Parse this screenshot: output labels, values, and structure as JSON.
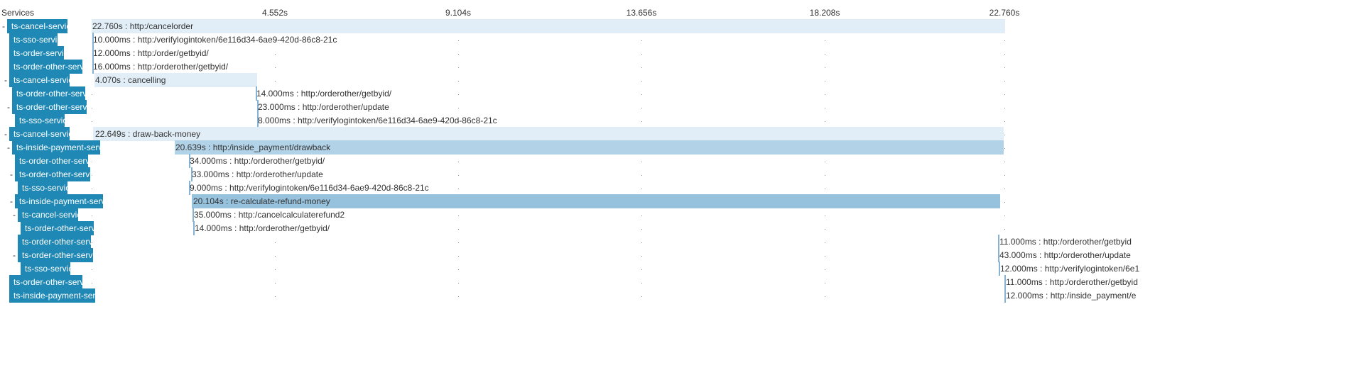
{
  "header": {
    "services_label": "Services",
    "ticks": [
      "4.552s",
      "9.104s",
      "13.656s",
      "18.208s",
      "22.760s"
    ]
  },
  "colors": {
    "service_bg": "#1f88b4",
    "span_light": "#e2eef7",
    "span_medium": "#b2d2e7",
    "span_dark": "#97c2dd"
  },
  "rows": [
    {
      "service": "ts-cancel-service",
      "toggle": "-",
      "label": "22.760s : http:/cancelorder"
    },
    {
      "service": "ts-sso-service",
      "toggle": "",
      "label": "10.000ms : http:/verifylogintoken/6e116d34-6ae9-420d-86c8-21c"
    },
    {
      "service": "ts-order-service",
      "toggle": "",
      "label": "12.000ms : http:/order/getbyid/"
    },
    {
      "service": "ts-order-other-service",
      "toggle": "",
      "label": "16.000ms : http:/orderother/getbyid/"
    },
    {
      "service": "ts-cancel-service",
      "toggle": "-",
      "label": "4.070s : cancelling"
    },
    {
      "service": "ts-order-other-service",
      "toggle": "",
      "label": "14.000ms : http:/orderother/getbyid/"
    },
    {
      "service": "ts-order-other-service",
      "toggle": "-",
      "label": "23.000ms : http:/orderother/update"
    },
    {
      "service": "ts-sso-service",
      "toggle": "",
      "label": "8.000ms : http:/verifylogintoken/6e116d34-6ae9-420d-86c8-21c"
    },
    {
      "service": "ts-cancel-service",
      "toggle": "-",
      "label": "22.649s : draw-back-money"
    },
    {
      "service": "ts-inside-payment-service",
      "toggle": "-",
      "label": "20.639s : http:/inside_payment/drawback"
    },
    {
      "service": "ts-order-other-service",
      "toggle": "",
      "label": "34.000ms : http:/orderother/getbyid/"
    },
    {
      "service": "ts-order-other-service",
      "toggle": "-",
      "label": "33.000ms : http:/orderother/update"
    },
    {
      "service": "ts-sso-service",
      "toggle": "",
      "label": "9.000ms : http:/verifylogintoken/6e116d34-6ae9-420d-86c8-21c"
    },
    {
      "service": "ts-inside-payment-service",
      "toggle": "-",
      "label": "20.104s : re-calculate-refund-money"
    },
    {
      "service": "ts-cancel-service",
      "toggle": "-",
      "label": "35.000ms : http:/cancelcalculaterefund2"
    },
    {
      "service": "ts-order-other-service",
      "toggle": "",
      "label": "14.000ms : http:/orderother/getbyid/"
    },
    {
      "service": "ts-order-other-service",
      "toggle": "",
      "label": "11.000ms : http:/orderother/getbyid"
    },
    {
      "service": "ts-order-other-service",
      "toggle": "-",
      "label": "43.000ms : http:/orderother/update"
    },
    {
      "service": "ts-sso-service",
      "toggle": "",
      "label": "12.000ms : http:/verifylogintoken/6e1"
    },
    {
      "service": "ts-order-other-service",
      "toggle": "",
      "label": "11.000ms : http:/orderother/getbyid"
    },
    {
      "service": "ts-inside-payment-service",
      "toggle": "",
      "label": "12.000ms : http:/inside_payment/e"
    }
  ]
}
